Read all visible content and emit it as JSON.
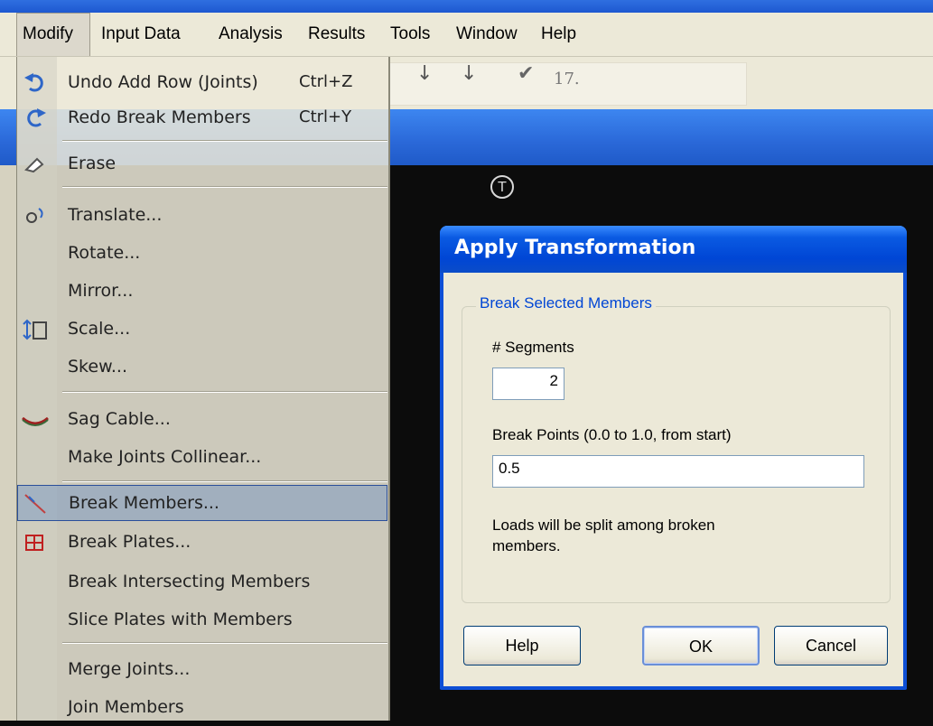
{
  "menubar": {
    "items": [
      {
        "label": "Modify",
        "active": true
      },
      {
        "label": "Input Data"
      },
      {
        "label": "Analysis"
      },
      {
        "label": "Results"
      },
      {
        "label": "Tools"
      },
      {
        "label": "Window"
      },
      {
        "label": "Help"
      }
    ]
  },
  "toolbar": {
    "sort_asc_icon": "sort-ascending-icon",
    "sort_desc_icon": "sort-descending-icon",
    "check_icon": "checkmark-icon",
    "count_text": "17."
  },
  "modify_menu": {
    "items": [
      {
        "label": "Undo Add Row (Joints)",
        "shortcut": "Ctrl+Z",
        "icon": "undo-icon"
      },
      {
        "label": "Redo Break Members",
        "shortcut": "Ctrl+Y",
        "icon": "redo-icon"
      },
      {
        "label": "Erase",
        "icon": "eraser-icon"
      },
      {
        "label": "Translate...",
        "icon": "translate-icon"
      },
      {
        "label": "Rotate..."
      },
      {
        "label": "Mirror..."
      },
      {
        "label": "Scale...",
        "icon": "scale-icon"
      },
      {
        "label": "Skew..."
      },
      {
        "label": "Sag Cable...",
        "icon": "sag-cable-icon"
      },
      {
        "label": "Make Joints Collinear..."
      },
      {
        "label": "Break Members...",
        "icon": "break-members-icon",
        "highlighted": true
      },
      {
        "label": "Break Plates...",
        "icon": "break-plates-icon"
      },
      {
        "label": "Break Intersecting Members"
      },
      {
        "label": "Slice Plates with Members"
      },
      {
        "label": "Merge Joints..."
      },
      {
        "label": "Join Members"
      }
    ]
  },
  "canvas": {
    "origin_marker": "T"
  },
  "dialog": {
    "title": "Apply Transformation",
    "group_label": "Break Selected Members",
    "segments_label": "# Segments",
    "segments_value": "2",
    "break_points_label": "Break Points (0.0 to 1.0, from start)",
    "break_points_value": "0.5",
    "note_line1": "Loads will be split among broken",
    "note_line2": "members.",
    "buttons": {
      "help": "Help",
      "ok": "OK",
      "cancel": "Cancel"
    }
  },
  "colors": {
    "xp_blue": "#0046d5",
    "menu_bg": "#ece9d8",
    "canvas_bg": "#0c0c0c",
    "highlight": "#316ac5"
  }
}
